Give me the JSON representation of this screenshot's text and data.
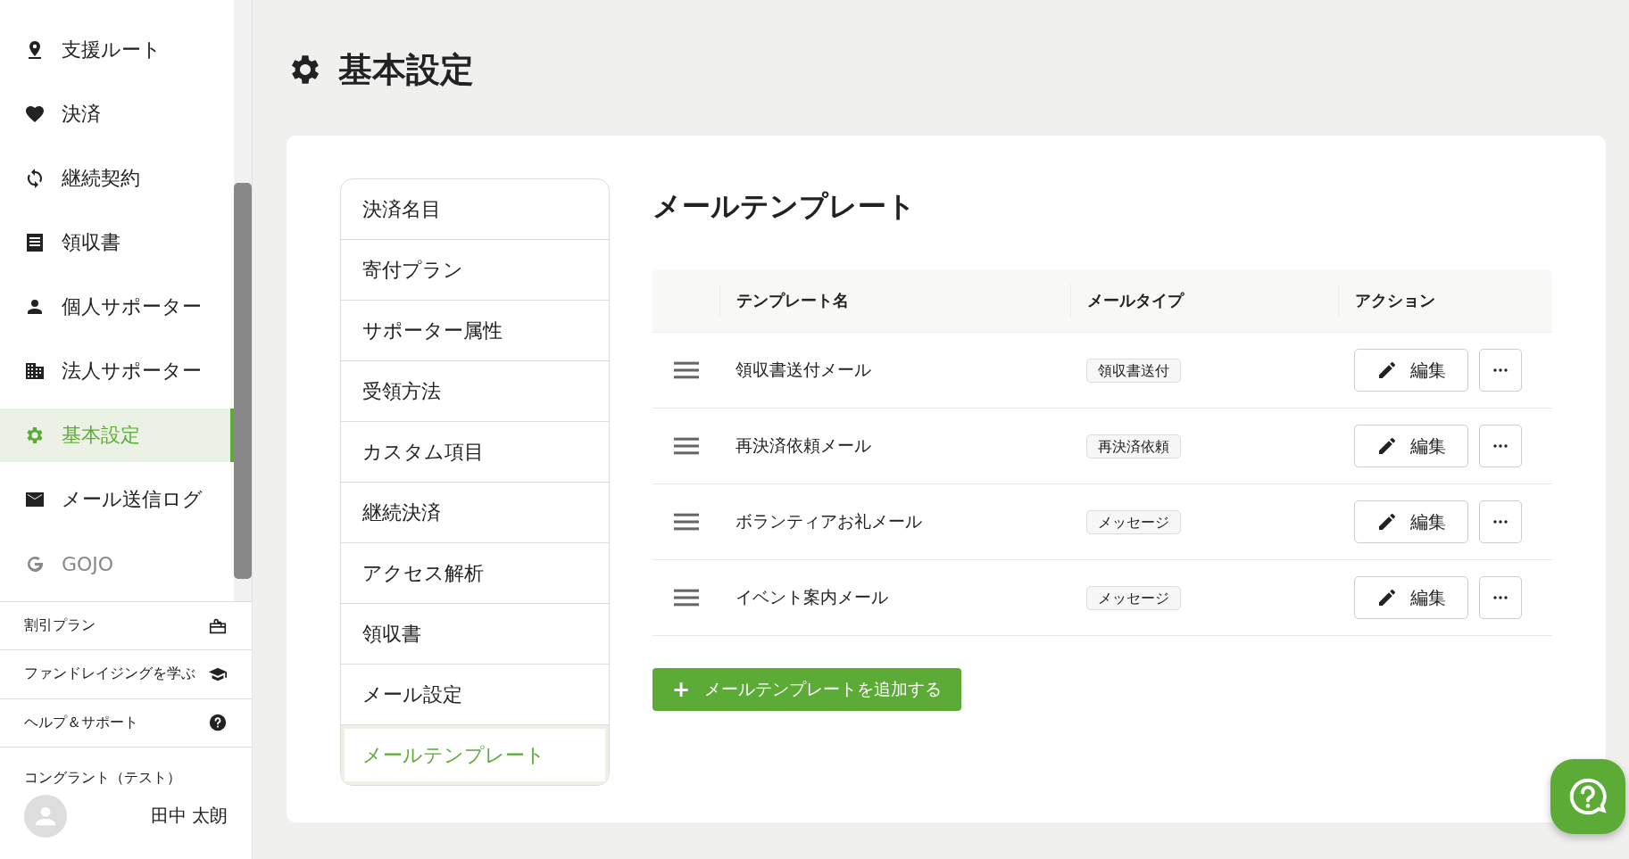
{
  "sidebar": {
    "items": [
      {
        "label": "支援ルート",
        "selected": false,
        "disabled": false
      },
      {
        "label": "決済",
        "selected": false,
        "disabled": false
      },
      {
        "label": "継続契約",
        "selected": false,
        "disabled": false
      },
      {
        "label": "領収書",
        "selected": false,
        "disabled": false
      },
      {
        "label": "個人サポーター",
        "selected": false,
        "disabled": false
      },
      {
        "label": "法人サポーター",
        "selected": false,
        "disabled": false
      },
      {
        "label": "基本設定",
        "selected": true,
        "disabled": false
      },
      {
        "label": "メール送信ログ",
        "selected": false,
        "disabled": false
      },
      {
        "label": "GOJO",
        "selected": false,
        "disabled": true
      }
    ],
    "links": [
      {
        "label": "割引プラン"
      },
      {
        "label": "ファンドレイジングを学ぶ"
      },
      {
        "label": "ヘルプ＆サポート"
      }
    ],
    "account": {
      "organization": "コングラント（テスト）",
      "user": "田中 太朗"
    }
  },
  "page": {
    "title": "基本設定"
  },
  "settings_menu": [
    {
      "label": "決済名目",
      "selected": false
    },
    {
      "label": "寄付プラン",
      "selected": false
    },
    {
      "label": "サポーター属性",
      "selected": false
    },
    {
      "label": "受領方法",
      "selected": false
    },
    {
      "label": "カスタム項目",
      "selected": false
    },
    {
      "label": "継続決済",
      "selected": false
    },
    {
      "label": "アクセス解析",
      "selected": false
    },
    {
      "label": "領収書",
      "selected": false
    },
    {
      "label": "メール設定",
      "selected": false
    },
    {
      "label": "メールテンプレート",
      "selected": true
    }
  ],
  "section": {
    "title": "メールテンプレート",
    "table": {
      "columns": [
        "テンプレート名",
        "メールタイプ",
        "アクション"
      ],
      "rows": [
        {
          "name": "領収書送付メール",
          "type": "領収書送付",
          "edit": "編集"
        },
        {
          "name": "再決済依頼メール",
          "type": "再決済依頼",
          "edit": "編集"
        },
        {
          "name": "ボランティアお礼メール",
          "type": "メッセージ",
          "edit": "編集"
        },
        {
          "name": "イベント案内メール",
          "type": "メッセージ",
          "edit": "編集"
        }
      ]
    },
    "add_button": {
      "icon": "+",
      "label": "メールテンプレートを追加する"
    }
  }
}
